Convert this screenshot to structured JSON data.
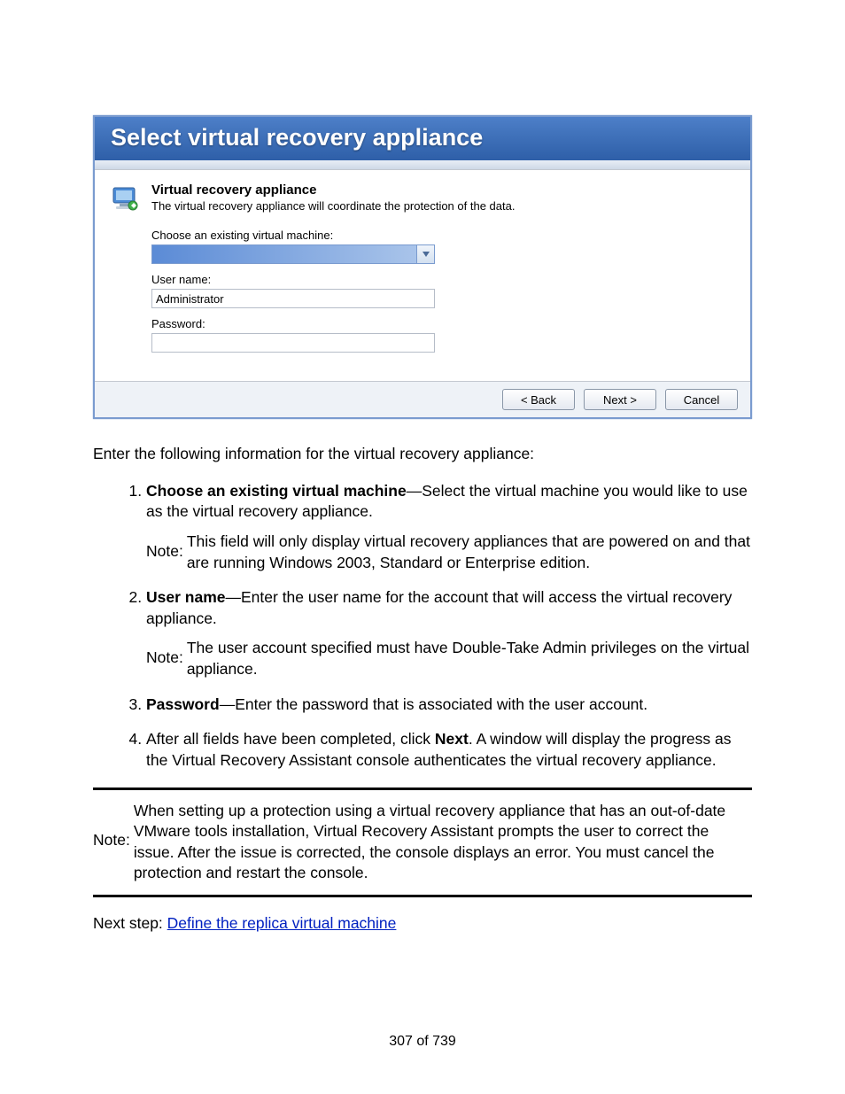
{
  "dialog": {
    "title": "Select virtual recovery appliance",
    "section_title": "Virtual recovery appliance",
    "section_desc": "The virtual recovery appliance will coordinate the protection of the data.",
    "choose_label": "Choose an existing virtual machine:",
    "combo_value": "",
    "user_label": "User name:",
    "user_value": "Administrator",
    "password_label": "Password:",
    "password_value": "",
    "buttons": {
      "back": "< Back",
      "next": "Next >",
      "cancel": "Cancel"
    }
  },
  "intro": "Enter the following information for the virtual recovery appliance:",
  "items": [
    {
      "label": "Choose an existing virtual machine",
      "desc": "—Select the virtual machine you would like to use as the virtual recovery appliance.",
      "note": "This field will only display virtual recovery appliances that are powered on and that are running Windows 2003, Standard or Enterprise edition."
    },
    {
      "label": "User name",
      "desc": "—Enter the user name for the account that will access the virtual recovery appliance.",
      "note": "The user account specified must have Double-Take Admin privileges on the virtual appliance."
    },
    {
      "label": "Password",
      "desc": "—Enter the password that is associated with the user account."
    },
    {
      "plain_pre": "After all fields have been completed, click ",
      "plain_bold": "Next",
      "plain_post": ". A window will display the progress as the Virtual Recovery Assistant console authenticates the virtual recovery appliance."
    }
  ],
  "note_label": "Note:",
  "big_note": "When setting up a protection using a virtual recovery appliance that has an out-of-date VMware tools installation, Virtual Recovery Assistant prompts the user to correct the issue. After the issue is corrected, the console displays an error. You must cancel the protection and restart the console.",
  "next_step_label": "Next step: ",
  "next_step_link": "Define the replica virtual machine",
  "page_number": "307 of 739"
}
